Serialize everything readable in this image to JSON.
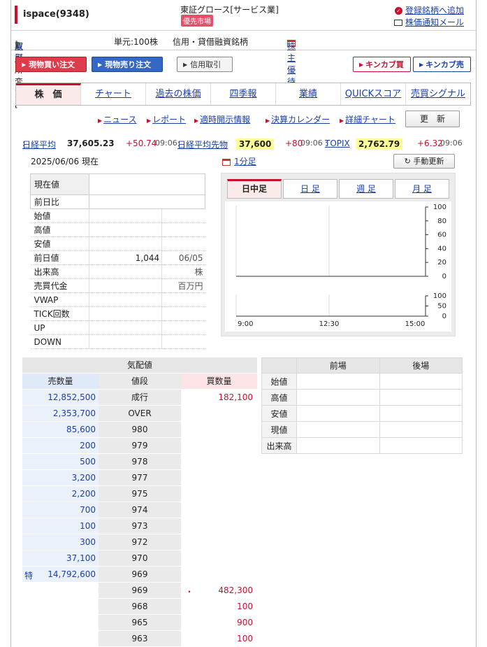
{
  "header": {
    "title": "ispace(9348)",
    "market": "東証グロース[サービス業]",
    "badge": "優先市場",
    "add_watch": "登録銘柄へ追加",
    "price_mail": "株価通知メール"
  },
  "info": {
    "exchange_label": "取引所変更:[",
    "exchange_link": "東証",
    "exchange_close": "]",
    "unit": "単元:100株",
    "margin": "信用・貸借融資銘柄",
    "yutai": "株主優待"
  },
  "buttons": {
    "buy": "現物買い注文",
    "sell": "現物売り注文",
    "credit": "信用取引",
    "kinkabu_buy": "キンカブ買",
    "kinkabu_sell": "キンカブ売"
  },
  "tabs": [
    "株　価",
    "チャート",
    "過去の株価",
    "四季報",
    "業績",
    "QUICKスコア",
    "売買シグナル"
  ],
  "sublinks": [
    "ニュース",
    "レポート",
    "適時開示情報",
    "決算カレンダー",
    "詳細チャート"
  ],
  "update_label": "更　新",
  "indices": {
    "nikkei_label": "日経平均",
    "nikkei_colon": ":",
    "nikkei_value": "37,605.23",
    "nikkei_change": "+50.74",
    "nikkei_time": "09:06",
    "futures_label": "日経平均先物",
    "futures_colon": ":",
    "futures_value": "37,600",
    "futures_change": "+80",
    "futures_time": "09:06",
    "topix_label": "TOPIX",
    "topix_colon": ":",
    "topix_value": "2,762.79",
    "topix_change": "+6.32",
    "topix_time": "09:06"
  },
  "asof": "2025/06/06 現在",
  "one_min": "1分足",
  "manual_update": "手動更新",
  "price_table": {
    "current_label": "現在値",
    "change_label": "前日比",
    "rows": [
      {
        "k": "始値",
        "v": "",
        "d": ""
      },
      {
        "k": "高値",
        "v": "",
        "d": ""
      },
      {
        "k": "安値",
        "v": "",
        "d": ""
      },
      {
        "k": "前日値",
        "v": "1,044",
        "d": "06/05"
      },
      {
        "k": "出来高",
        "v": "",
        "d": "株"
      },
      {
        "k": "売買代金",
        "v": "",
        "d": "百万円"
      },
      {
        "k": "VWAP",
        "v": "",
        "d": ""
      },
      {
        "k": "TICK回数",
        "v": "",
        "d": ""
      },
      {
        "k": "UP",
        "v": "",
        "d": ""
      },
      {
        "k": "DOWN",
        "v": "",
        "d": ""
      }
    ]
  },
  "chart_tabs": [
    "日中足",
    "日 足",
    "週 足",
    "月 足"
  ],
  "chart": {
    "price_ticks": [
      "100",
      "80",
      "60",
      "40",
      "20",
      "0"
    ],
    "volume_ticks": [
      "100",
      "50",
      "0"
    ],
    "time_ticks": [
      "9:00",
      "12:30",
      "15:00"
    ]
  },
  "orderbook": {
    "title": "気配値",
    "ask_header": "売数量",
    "price_header": "値段",
    "bid_header": "買数量",
    "rows": [
      {
        "ask": "12,852,500",
        "price": "成行",
        "bid": "182,100",
        "y": true,
        "mark": "",
        "dot": ""
      },
      {
        "ask": "2,353,700",
        "price": "OVER",
        "bid": "",
        "y": true,
        "mark": "",
        "dot": ""
      },
      {
        "ask": "85,600",
        "price": "980",
        "bid": "",
        "y": true,
        "mark": "",
        "dot": ""
      },
      {
        "ask": "200",
        "price": "979",
        "bid": "",
        "y": false,
        "mark": "",
        "dot": ""
      },
      {
        "ask": "500",
        "price": "978",
        "bid": "",
        "y": false,
        "mark": "",
        "dot": ""
      },
      {
        "ask": "3,200",
        "price": "977",
        "bid": "",
        "y": false,
        "mark": "",
        "dot": ""
      },
      {
        "ask": "2,200",
        "price": "975",
        "bid": "",
        "y": false,
        "mark": "",
        "dot": ""
      },
      {
        "ask": "700",
        "price": "974",
        "bid": "",
        "y": false,
        "mark": "",
        "dot": ""
      },
      {
        "ask": "100",
        "price": "973",
        "bid": "",
        "y": false,
        "mark": "",
        "dot": ""
      },
      {
        "ask": "300",
        "price": "972",
        "bid": "",
        "y": false,
        "mark": "",
        "dot": ""
      },
      {
        "ask": "37,100",
        "price": "970",
        "bid": "",
        "y": false,
        "mark": "",
        "dot": ""
      },
      {
        "ask": "14,792,600",
        "price": "969",
        "bid": "",
        "y": true,
        "mark": "特",
        "dot": ""
      },
      {
        "ask": "",
        "price": "969",
        "bid": "482,300",
        "y": false,
        "mark": "",
        "dot": "・"
      },
      {
        "ask": "",
        "price": "968",
        "bid": "100",
        "y": false,
        "mark": "",
        "dot": ""
      },
      {
        "ask": "",
        "price": "965",
        "bid": "900",
        "y": false,
        "mark": "",
        "dot": ""
      },
      {
        "ask": "",
        "price": "963",
        "bid": "100",
        "y": false,
        "mark": "",
        "dot": ""
      }
    ]
  },
  "session": {
    "morning": "前場",
    "afternoon": "後場",
    "rows": [
      "始値",
      "高値",
      "安値",
      "現値",
      "出来高"
    ]
  }
}
